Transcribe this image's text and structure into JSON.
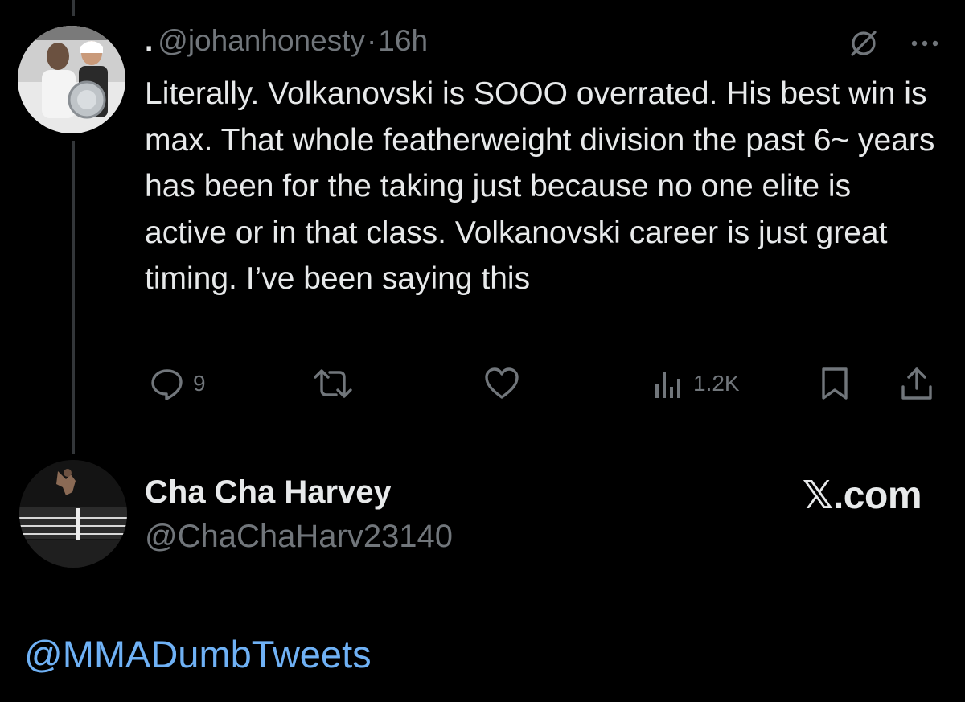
{
  "tweet": {
    "dot_name": ".",
    "handle": "@johanhonesty",
    "separator": "·",
    "time": "16h",
    "text": "Literally. Volkanovski is SOOO overrated. His best win is max. That whole featherweight division the past 6~ years has been for the taking just because no one elite is active or in that class. Volkanovski career is just great timing. I’ve been saying this",
    "actions": {
      "reply_icon": "reply-icon",
      "reply_count": "9",
      "retweet_icon": "retweet-icon",
      "like_icon": "heart-icon",
      "views_icon": "views-icon",
      "views_count": "1.2K",
      "bookmark_icon": "bookmark-icon",
      "share_icon": "share-icon"
    },
    "top_icons": [
      "grok-icon",
      "more-icon"
    ]
  },
  "footer_user": {
    "name": "Cha Cha Harvey",
    "handle": "@ChaChaHarv23140",
    "brand": "𝕏.com"
  },
  "credit": "@MMADumbTweets",
  "colors": {
    "background": "#000000",
    "text_primary": "#e7e9ea",
    "text_secondary": "#71767b",
    "link": "#6fb1f5"
  }
}
